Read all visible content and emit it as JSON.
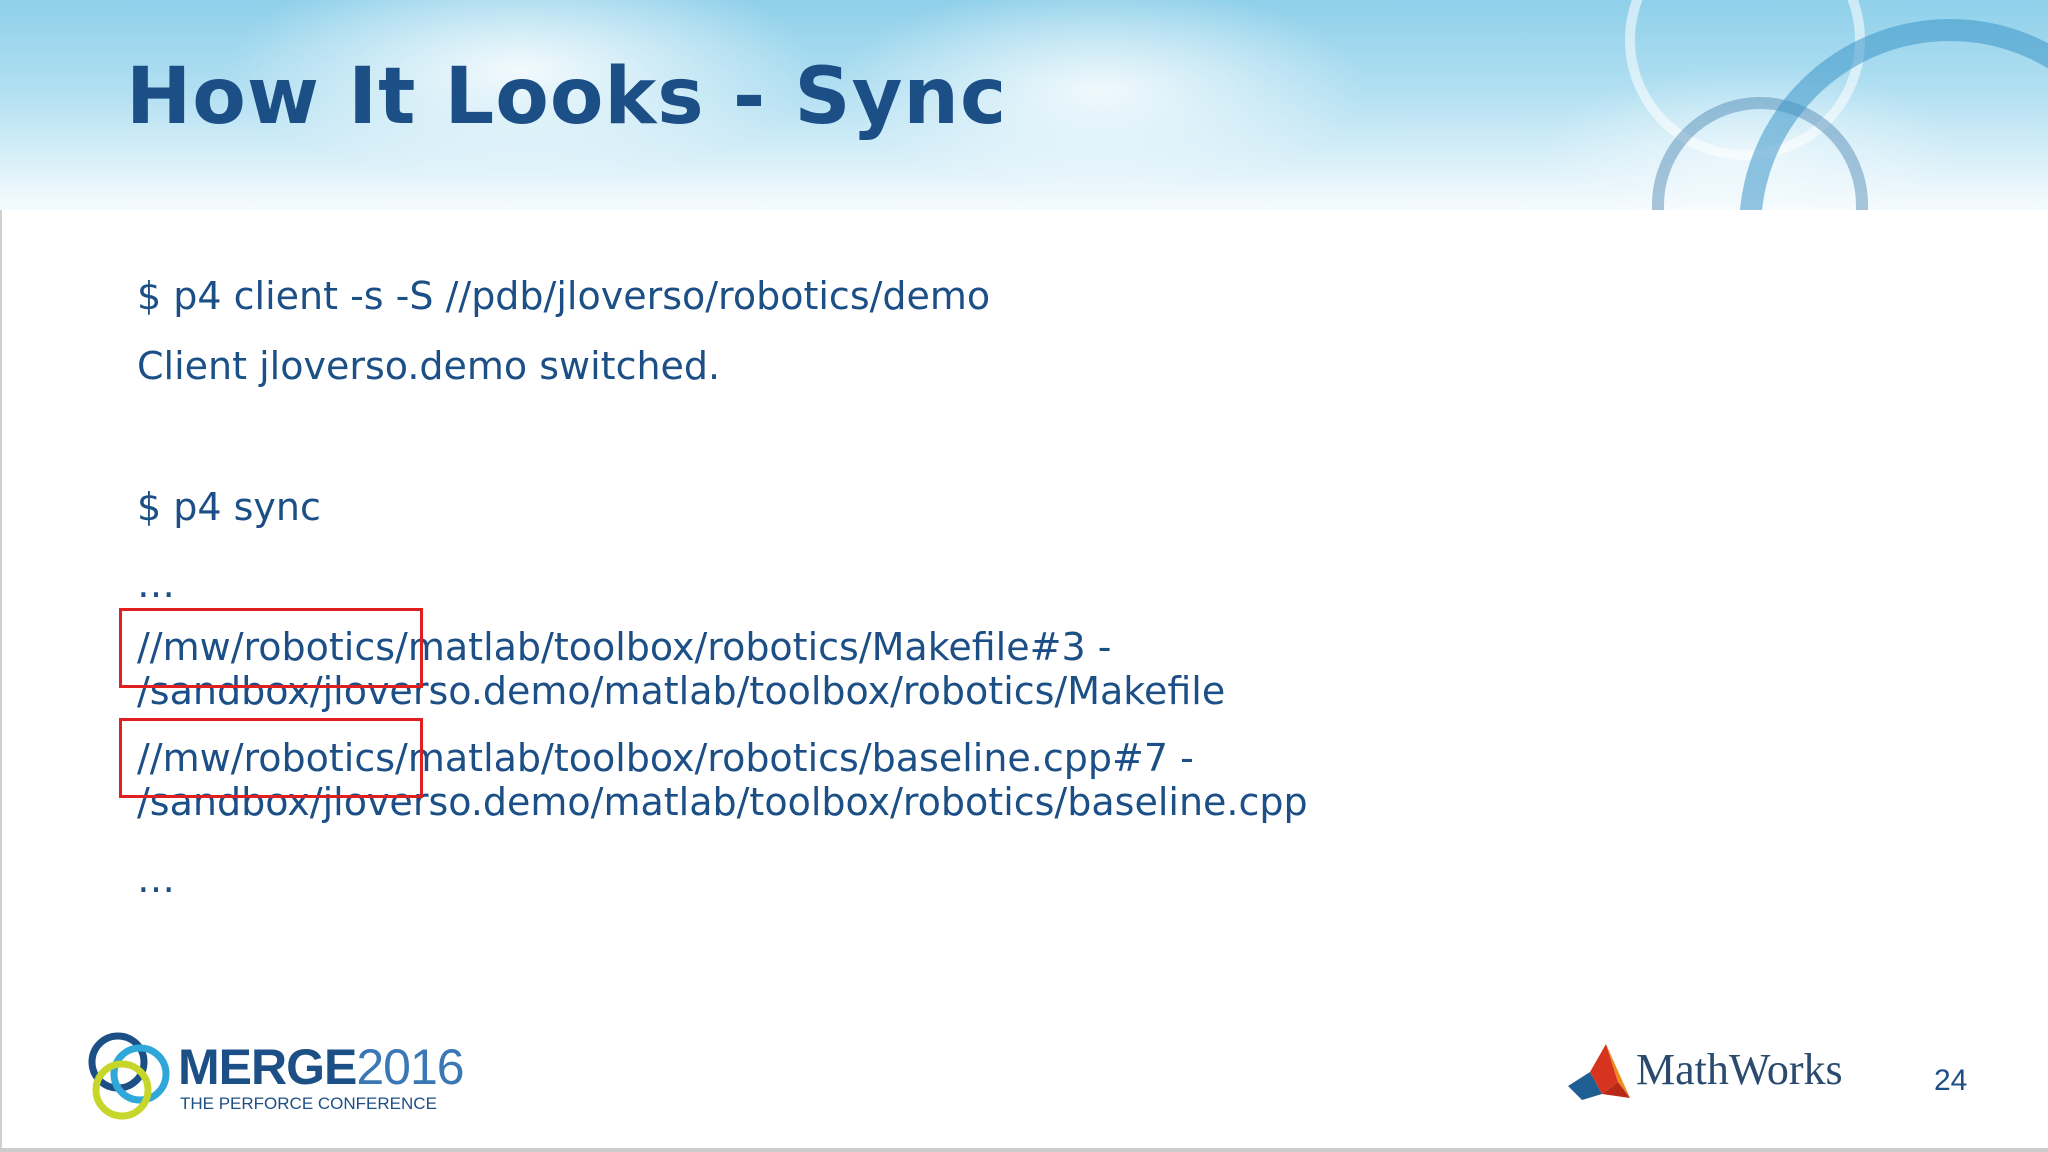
{
  "slide": {
    "title": "How It Looks - Sync",
    "lines": [
      "$ p4 client -s -S //pdb/jloverso/robotics/demo",
      "Client jloverso.demo switched.",
      "$ p4 sync",
      "…",
      "//mw/robotics/matlab/toolbox/robotics/Makefile#3 -",
      "/sandbox/jloverso.demo/matlab/toolbox/robotics/Makefile",
      "//mw/robotics/matlab/toolbox/robotics/baseline.cpp#7 -",
      "/sandbox/jloverso.demo/matlab/toolbox/robotics/baseline.cpp",
      "…"
    ],
    "page_number": "24"
  },
  "footer": {
    "merge_logo": {
      "word": "MERGE",
      "year": "2016",
      "subtitle": "THE PERFORCE CONFERENCE"
    },
    "mathworks_logo": {
      "word": "MathWorks"
    }
  },
  "colors": {
    "title": "#1c4f86",
    "body_text": "#1c4f86",
    "highlight_box": "#e02020"
  }
}
